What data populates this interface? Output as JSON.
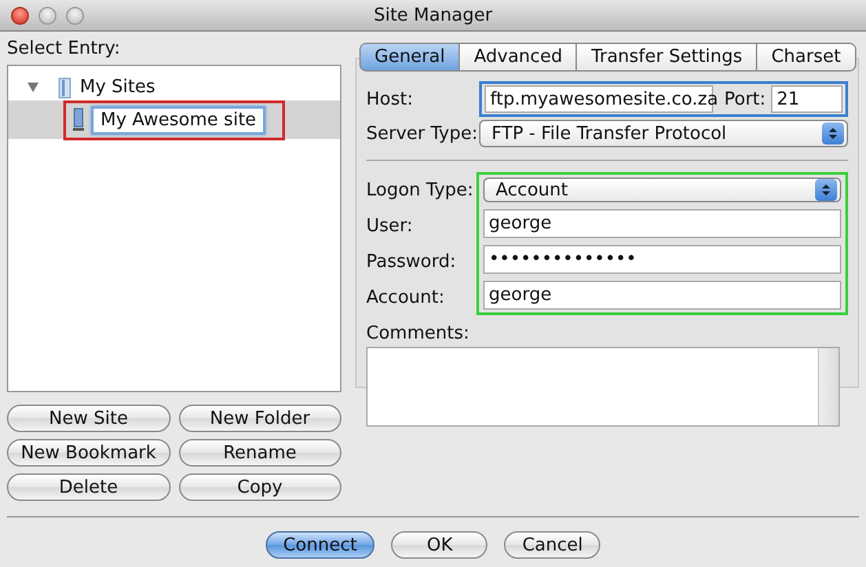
{
  "window": {
    "title": "Site Manager"
  },
  "entry_label": "Select Entry:",
  "tree": [
    {
      "label": "My Sites",
      "expanded": true,
      "selected": false,
      "children": [
        {
          "label": "My Awesome site",
          "selected": true,
          "editing": true,
          "color": "#d02a2a"
        }
      ]
    }
  ],
  "site_buttons": [
    "New Site",
    "New Folder",
    "New Bookmark",
    "Rename",
    "Delete",
    "Copy"
  ],
  "tabs": [
    {
      "label": "General",
      "selected": true
    },
    {
      "label": "Advanced",
      "selected": false
    },
    {
      "label": "Transfer Settings",
      "selected": false
    },
    {
      "label": "Charset",
      "selected": false
    }
  ],
  "server": {
    "color": "#3a7fd0",
    "host_label": "Host:",
    "host": "ftp.myawesomesite.co.za",
    "port_label": "Port:",
    "port": "21",
    "type_label": "Server Type:",
    "type": "FTP - File Transfer Protocol"
  },
  "logon": {
    "color": "#3ad03a",
    "type_label": "Logon Type:",
    "type": "Account",
    "fields": [
      {
        "label": "User:",
        "value": "george"
      },
      {
        "label": "Password:",
        "value": "••••••••••••••"
      },
      {
        "label": "Account:",
        "value": "george"
      }
    ]
  },
  "comments_label": "Comments:",
  "footer_buttons": [
    {
      "label": "Connect",
      "default": true
    },
    {
      "label": "OK",
      "default": false
    },
    {
      "label": "Cancel",
      "default": false
    }
  ]
}
